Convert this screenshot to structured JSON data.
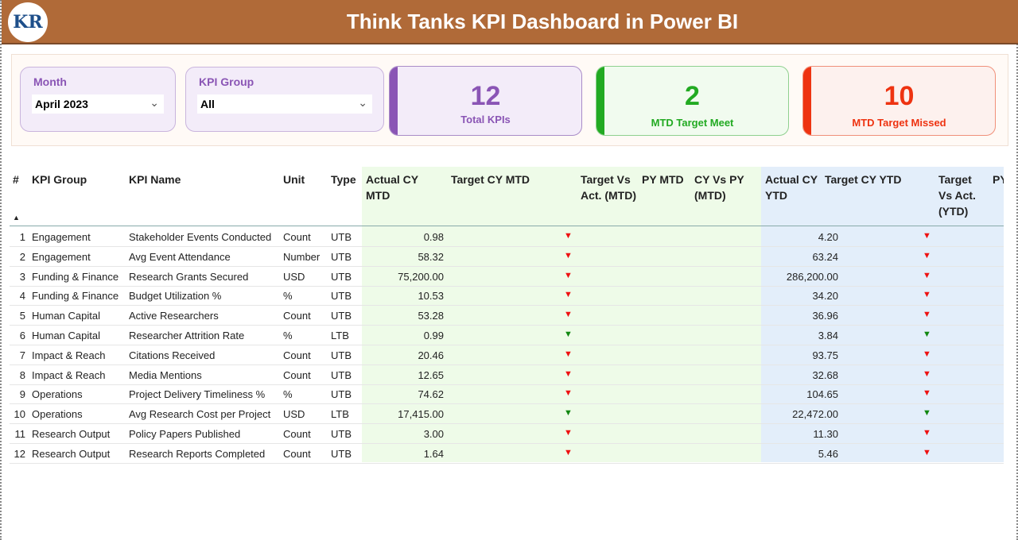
{
  "header": {
    "title": "Think Tanks KPI Dashboard in Power BI",
    "logo_text": "KR"
  },
  "slicers": {
    "month": {
      "label": "Month",
      "value": "April 2023"
    },
    "kpi_group": {
      "label": "KPI Group",
      "value": "All"
    }
  },
  "cards": {
    "total": {
      "value": "12",
      "label": "Total KPIs"
    },
    "meet": {
      "value": "2",
      "label": "MTD Target Meet"
    },
    "missed": {
      "value": "10",
      "label": "MTD Target Missed"
    }
  },
  "colors": {
    "header": "#b06a38",
    "purple": "#8a55b5",
    "green": "#22aa22",
    "red": "#ee3311"
  },
  "table": {
    "columns": [
      "#",
      "KPI Group",
      "KPI Name",
      "Unit",
      "Type",
      "Actual CY MTD",
      "Target CY MTD",
      "Target Vs Act. (MTD)",
      "PY MTD",
      "CY Vs PY (MTD)",
      "Actual CY YTD",
      "Target CY YTD",
      "Target Vs Act. (YTD)",
      "PY"
    ],
    "sort_icon": "▲",
    "rows": [
      {
        "n": "1",
        "group": "Engagement",
        "name": "Stakeholder Events Conducted",
        "unit": "Count",
        "type": "UTB",
        "mtd": "0.98",
        "mtd_status": "down",
        "ytd": "4.20",
        "ytd_status": "down"
      },
      {
        "n": "2",
        "group": "Engagement",
        "name": "Avg Event Attendance",
        "unit": "Number",
        "type": "UTB",
        "mtd": "58.32",
        "mtd_status": "down",
        "ytd": "63.24",
        "ytd_status": "down"
      },
      {
        "n": "3",
        "group": "Funding & Finance",
        "name": "Research Grants Secured",
        "unit": "USD",
        "type": "UTB",
        "mtd": "75,200.00",
        "mtd_status": "down",
        "ytd": "286,200.00",
        "ytd_status": "down"
      },
      {
        "n": "4",
        "group": "Funding & Finance",
        "name": "Budget Utilization %",
        "unit": "%",
        "type": "UTB",
        "mtd": "10.53",
        "mtd_status": "down",
        "ytd": "34.20",
        "ytd_status": "down"
      },
      {
        "n": "5",
        "group": "Human Capital",
        "name": "Active Researchers",
        "unit": "Count",
        "type": "UTB",
        "mtd": "53.28",
        "mtd_status": "down",
        "ytd": "36.96",
        "ytd_status": "down"
      },
      {
        "n": "6",
        "group": "Human Capital",
        "name": "Researcher Attrition Rate",
        "unit": "%",
        "type": "LTB",
        "mtd": "0.99",
        "mtd_status": "up",
        "ytd": "3.84",
        "ytd_status": "up"
      },
      {
        "n": "7",
        "group": "Impact & Reach",
        "name": "Citations Received",
        "unit": "Count",
        "type": "UTB",
        "mtd": "20.46",
        "mtd_status": "down",
        "ytd": "93.75",
        "ytd_status": "down"
      },
      {
        "n": "8",
        "group": "Impact & Reach",
        "name": "Media Mentions",
        "unit": "Count",
        "type": "UTB",
        "mtd": "12.65",
        "mtd_status": "down",
        "ytd": "32.68",
        "ytd_status": "down"
      },
      {
        "n": "9",
        "group": "Operations",
        "name": "Project Delivery Timeliness %",
        "unit": "%",
        "type": "UTB",
        "mtd": "74.62",
        "mtd_status": "down",
        "ytd": "104.65",
        "ytd_status": "down"
      },
      {
        "n": "10",
        "group": "Operations",
        "name": "Avg Research Cost per Project",
        "unit": "USD",
        "type": "LTB",
        "mtd": "17,415.00",
        "mtd_status": "up",
        "ytd": "22,472.00",
        "ytd_status": "up"
      },
      {
        "n": "11",
        "group": "Research Output",
        "name": "Policy Papers Published",
        "unit": "Count",
        "type": "UTB",
        "mtd": "3.00",
        "mtd_status": "down",
        "ytd": "11.30",
        "ytd_status": "down"
      },
      {
        "n": "12",
        "group": "Research Output",
        "name": "Research Reports Completed",
        "unit": "Count",
        "type": "UTB",
        "mtd": "1.64",
        "mtd_status": "down",
        "ytd": "5.46",
        "ytd_status": "down"
      }
    ]
  }
}
